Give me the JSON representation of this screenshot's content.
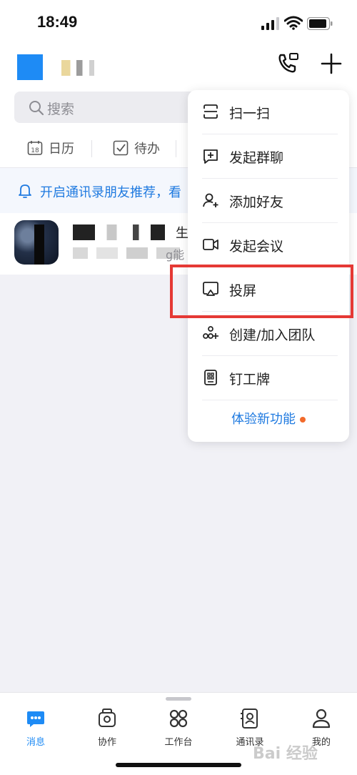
{
  "status": {
    "time": "18:49"
  },
  "search": {
    "placeholder": "搜索"
  },
  "quick": {
    "calendar_label": "日历",
    "calendar_day": "18",
    "todo_label": "待办"
  },
  "notice": {
    "text": "开启通讯录朋友推荐，看"
  },
  "chat": {
    "name_suffix": "生",
    "message_suffix": "g能"
  },
  "menu": {
    "items": [
      {
        "label": "扫一扫",
        "icon": "scan-icon"
      },
      {
        "label": "发起群聊",
        "icon": "group-chat-icon"
      },
      {
        "label": "添加好友",
        "icon": "add-friend-icon"
      },
      {
        "label": "发起会议",
        "icon": "video-meeting-icon"
      },
      {
        "label": "投屏",
        "icon": "screen-cast-icon"
      },
      {
        "label": "创建/加入团队",
        "icon": "team-icon"
      },
      {
        "label": "钉工牌",
        "icon": "badge-icon"
      }
    ],
    "try_new": "体验新功能"
  },
  "tabs": [
    {
      "label": "消息",
      "icon": "message-icon",
      "active": true
    },
    {
      "label": "协作",
      "icon": "collab-icon"
    },
    {
      "label": "工作台",
      "icon": "workbench-icon"
    },
    {
      "label": "通讯录",
      "icon": "contacts-icon"
    },
    {
      "label": "我的",
      "icon": "profile-icon"
    }
  ],
  "watermark": "Bai 经验",
  "colors": {
    "accent": "#1e8bf5",
    "highlight": "#e53935",
    "notice_bg": "#f4f7fd",
    "dot": "#f26a2b"
  }
}
